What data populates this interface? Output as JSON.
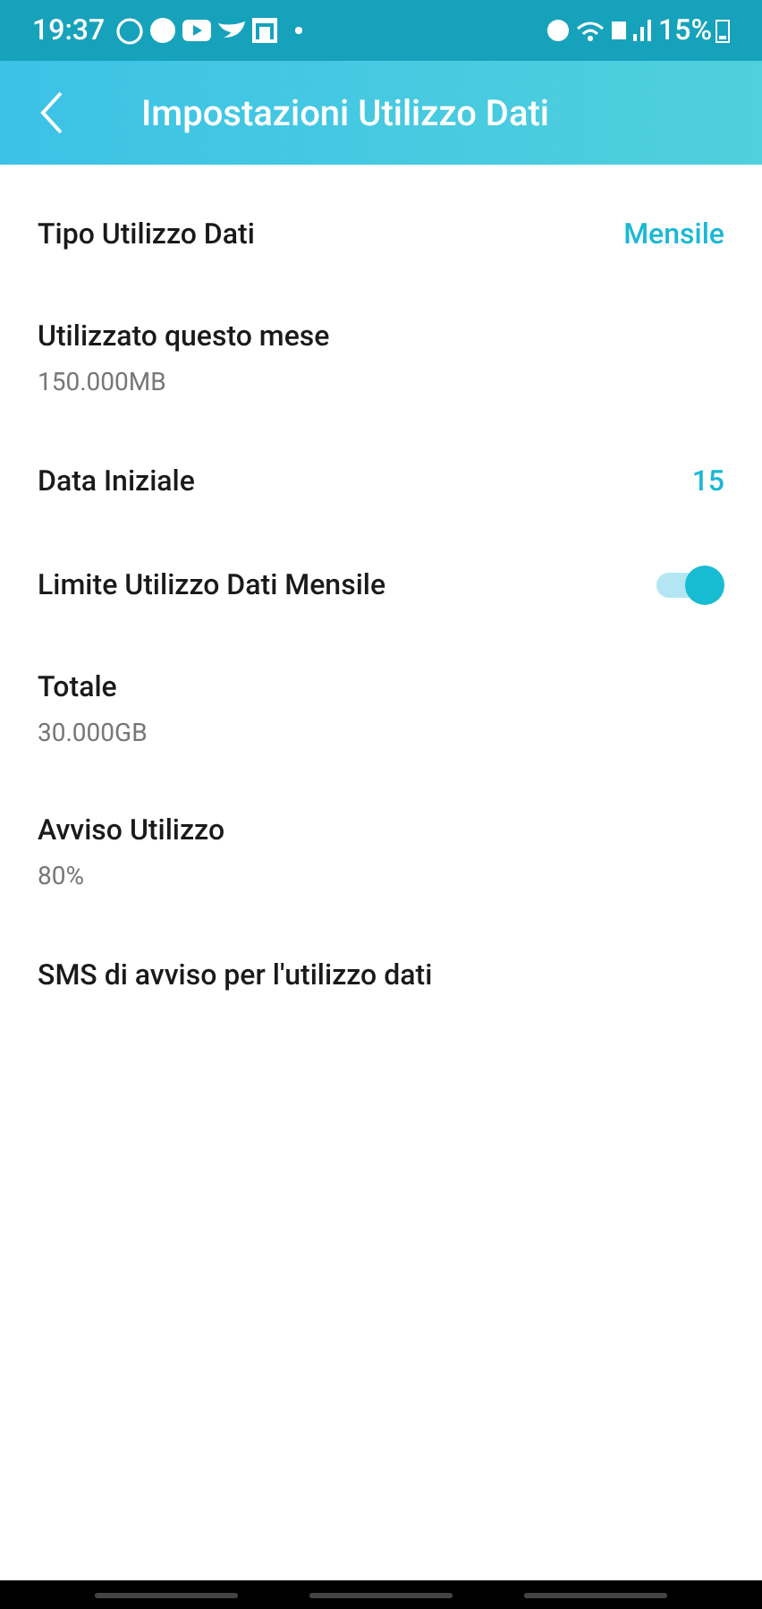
{
  "status_bar": {
    "time": "19:37",
    "battery": "15%"
  },
  "header": {
    "title": "Impostazioni Utilizzo Dati"
  },
  "rows": [
    {
      "kind": "value",
      "label": "Tipo Utilizzo Dati",
      "value": "Mensile"
    },
    {
      "kind": "sub",
      "label": "Utilizzato questo mese",
      "detail": "150.000MB"
    },
    {
      "kind": "value",
      "label": "Data Iniziale",
      "value": "15"
    },
    {
      "kind": "toggle",
      "label": "Limite Utilizzo Dati Mensile",
      "on": true
    },
    {
      "kind": "sub",
      "label": "Totale",
      "detail": "30.000GB"
    },
    {
      "kind": "sub",
      "label": "Avviso Utilizzo",
      "detail": "80%"
    },
    {
      "kind": "plain",
      "label": "SMS di avviso per l'utilizzo dati"
    }
  ]
}
